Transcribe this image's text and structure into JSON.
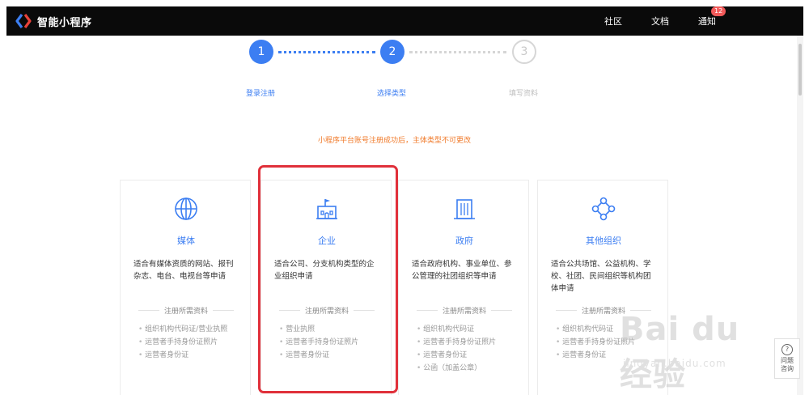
{
  "header": {
    "brand": "智能小程序",
    "nav": [
      {
        "label": "社区"
      },
      {
        "label": "文档"
      },
      {
        "label": "通知",
        "badge": "12"
      }
    ]
  },
  "steps": [
    {
      "number": "1",
      "label": "登录注册",
      "state": "done"
    },
    {
      "number": "2",
      "label": "选择类型",
      "state": "current"
    },
    {
      "number": "3",
      "label": "填写资料",
      "state": "pending"
    }
  ],
  "notice": "小程序平台账号注册成功后，主体类型不可更改",
  "cards": [
    {
      "icon": "globe-icon",
      "title": "媒体",
      "desc": "适合有媒体资质的网站、报刊杂志、电台、电视台等申请",
      "req_title": "注册所需资料",
      "reqs": [
        "组织机构代码证/营业执照",
        "运营者手持身份证照片",
        "运营者身份证"
      ]
    },
    {
      "icon": "castle-icon",
      "title": "企业",
      "desc": "适合公司、分支机构类型的企业组织申请",
      "req_title": "注册所需资料",
      "reqs": [
        "营业执照",
        "运营者手持身份证照片",
        "运营者身份证"
      ]
    },
    {
      "icon": "building-icon",
      "title": "政府",
      "desc": "适合政府机构、事业单位、参公管理的社团组织等申请",
      "req_title": "注册所需资料",
      "reqs": [
        "组织机构代码证",
        "运营者手持身份证照片",
        "运营者身份证",
        "公函（加盖公章）"
      ]
    },
    {
      "icon": "network-icon",
      "title": "其他组织",
      "desc": "适合公共场馆、公益机构、学校、社团、民间组织等机构团体申请",
      "req_title": "注册所需资料",
      "reqs": [
        "组织机构代码证",
        "运营者手持身份证照片",
        "运营者身份证"
      ]
    }
  ],
  "help": {
    "label1": "问题",
    "label2": "咨询"
  },
  "watermark": {
    "text": "Bai du 经验",
    "sub": "jingyan.baidu.com"
  },
  "colors": {
    "accent": "#3c7ef2",
    "notice": "#f07a2a",
    "highlight": "#e0303a",
    "header_bg": "#0a0a0a"
  }
}
